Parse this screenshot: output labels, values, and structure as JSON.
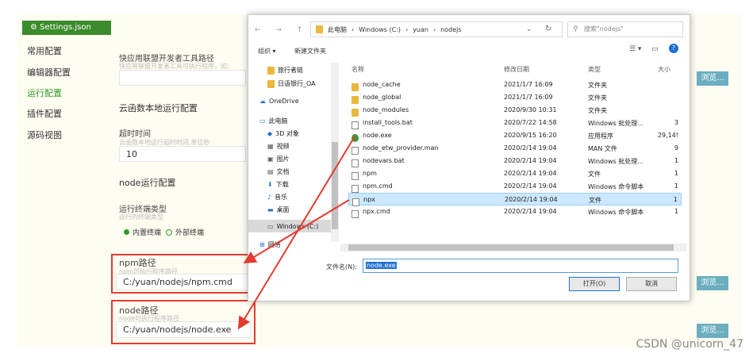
{
  "settings": {
    "tab_label": "⚙ Settings.json",
    "nav": [
      "常用配置",
      "编辑器配置",
      "运行配置",
      "插件配置",
      "源码视图"
    ],
    "quick_label": "快应用联盟开发者工具路径",
    "quick_hint": "快应用联盟开发者工具可执行程序，如：",
    "cloud_title": "云函数本地运行配置",
    "timeout_label": "超时时间",
    "timeout_hint": "云函数本地运行超时时间,单位秒",
    "timeout_value": "10",
    "node_title": "node运行配置",
    "terminal_label": "运行终端类型",
    "terminal_hint": "运行的终端类型",
    "terminal_opt1": "内置终端",
    "terminal_opt2": "外部终端",
    "npm_label": "npm路径",
    "npm_hint": "npm可执行程序路径",
    "npm_value": "C:/yuan/nodejs/npm.cmd",
    "node_label": "node路径",
    "node_hint": "node可执行程序路径",
    "node_value": "C:/yuan/nodejs/node.exe",
    "browse": "浏览..."
  },
  "dialog": {
    "breadcrumb": [
      "此电脑",
      "Windows (C:)",
      "yuan",
      "nodejs"
    ],
    "search_placeholder": "搜索\"nodejs\"",
    "toolbar_organize": "组织 ▾",
    "toolbar_new_folder": "新建文件夹",
    "tree": [
      {
        "label": "旅行者链",
        "icon": "folder"
      },
      {
        "label": "日语银行_OA",
        "icon": "folder"
      },
      {
        "label": "OneDrive",
        "icon": "cloud"
      },
      {
        "label": "此电脑",
        "icon": "pc"
      },
      {
        "label": "3D 对象",
        "icon": "cube"
      },
      {
        "label": "视频",
        "icon": "video"
      },
      {
        "label": "图片",
        "icon": "image"
      },
      {
        "label": "文档",
        "icon": "doc"
      },
      {
        "label": "下载",
        "icon": "download"
      },
      {
        "label": "音乐",
        "icon": "music"
      },
      {
        "label": "桌面",
        "icon": "desktop"
      },
      {
        "label": "Windows (C:)",
        "icon": "drive"
      },
      {
        "label": "网络",
        "icon": "network"
      }
    ],
    "columns": [
      "名称",
      "修改日期",
      "类型",
      "大小"
    ],
    "files": [
      {
        "name": "node_cache",
        "date": "2021/1/7 16:09",
        "type": "文件夹",
        "size": "",
        "icon": "folder"
      },
      {
        "name": "node_global",
        "date": "2021/1/7 16:09",
        "type": "文件夹",
        "size": "",
        "icon": "folder"
      },
      {
        "name": "node_modules",
        "date": "2020/9/30 10:31",
        "type": "文件夹",
        "size": "",
        "icon": "folder"
      },
      {
        "name": "install_tools.bat",
        "date": "2020/7/22 14:58",
        "type": "Windows 批处理...",
        "size": "3",
        "icon": "doc"
      },
      {
        "name": "node.exe",
        "date": "2020/9/15 16:20",
        "type": "应用程序",
        "size": "29,14!",
        "icon": "exe"
      },
      {
        "name": "node_etw_provider.man",
        "date": "2020/2/14 19:04",
        "type": "MAN 文件",
        "size": "9",
        "icon": "doc"
      },
      {
        "name": "nodevars.bat",
        "date": "2020/2/14 19:04",
        "type": "Windows 批处理...",
        "size": "1",
        "icon": "doc"
      },
      {
        "name": "npm",
        "date": "2020/2/14 19:04",
        "type": "文件",
        "size": "1",
        "icon": "doc"
      },
      {
        "name": "npm.cmd",
        "date": "2020/2/14 19:04",
        "type": "Windows 命令脚本",
        "size": "1",
        "icon": "doc"
      },
      {
        "name": "npx",
        "date": "2020/2/14 19:04",
        "type": "文件",
        "size": "1",
        "icon": "doc"
      },
      {
        "name": "npx.cmd",
        "date": "2020/2/14 19:04",
        "type": "Windows 命令脚本",
        "size": "1",
        "icon": "doc"
      }
    ],
    "selected_index": 9,
    "filename_label": "文件名(N):",
    "filename_value": "node.exe",
    "open_button": "打开(O)",
    "cancel_button": "取消"
  },
  "watermark": "CSDN @unicorn_47",
  "colors": {
    "accent_green": "#3c8b2c",
    "browse_blue": "#6aaec0",
    "annotation_red": "#e53b30",
    "selection": "#cce8ff"
  }
}
